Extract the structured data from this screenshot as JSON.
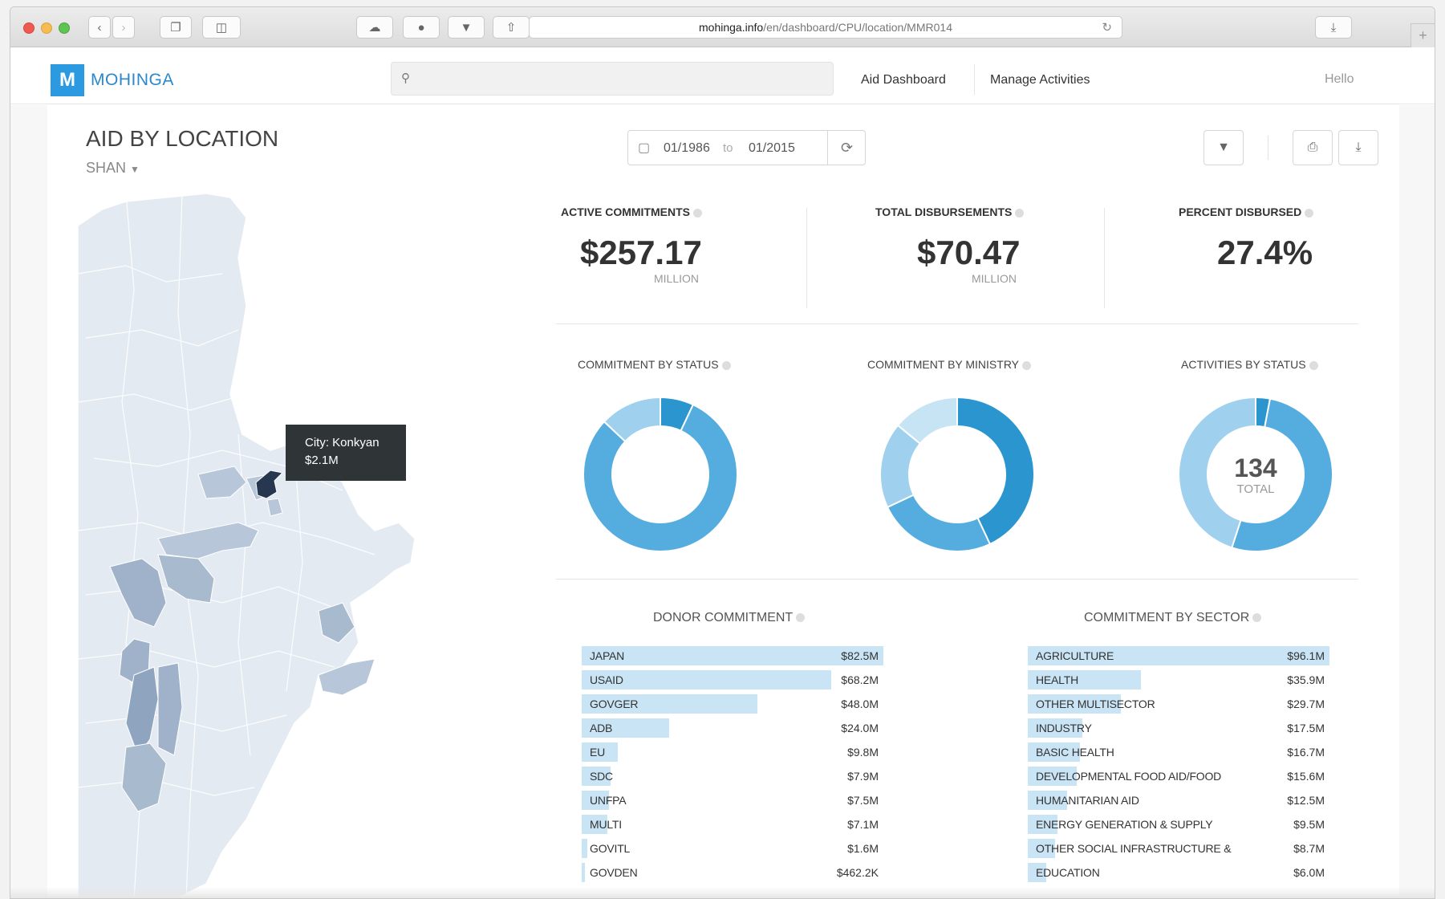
{
  "browser": {
    "url_host": "mohinga.info",
    "url_path": "/en/dashboard/CPU/location/MMR014"
  },
  "header": {
    "logo_letter": "M",
    "logo_text": "MOHINGA",
    "search_placeholder": "",
    "nav": [
      {
        "label": "Aid Dashboard"
      },
      {
        "label": "Manage Activities"
      }
    ],
    "greeting": "Hello"
  },
  "page": {
    "title": "AID BY LOCATION",
    "location": "SHAN",
    "date_from": "01/1986",
    "date_to_word": "to",
    "date_to": "01/2015"
  },
  "tooltip": {
    "line1": "City: Konkyan",
    "line2": "$2.1M"
  },
  "kpis": [
    {
      "label": "ACTIVE COMMITMENTS",
      "value": "$257.17",
      "unit": "MILLION"
    },
    {
      "label": "TOTAL DISBURSEMENTS",
      "value": "$70.47",
      "unit": "MILLION"
    },
    {
      "label": "PERCENT DISBURSED",
      "value": "27.4%",
      "unit": ""
    }
  ],
  "donuts": [
    {
      "label": "COMMITMENT BY STATUS",
      "center_value": "",
      "center_label": "",
      "fractions": [
        0.07,
        0.8,
        0.13
      ],
      "colors": [
        "#2a95cf",
        "#55addf",
        "#9fd0ee"
      ]
    },
    {
      "label": "COMMITMENT BY MINISTRY",
      "center_value": "",
      "center_label": "",
      "fractions": [
        0.43,
        0.25,
        0.18,
        0.14
      ],
      "colors": [
        "#2a95cf",
        "#55addf",
        "#9fd0ee",
        "#c7e4f5"
      ]
    },
    {
      "label": "ACTIVITIES BY STATUS",
      "center_value": "134",
      "center_label": "TOTAL",
      "fractions": [
        0.03,
        0.52,
        0.45
      ],
      "colors": [
        "#2a95cf",
        "#55addf",
        "#9fd0ee"
      ]
    }
  ],
  "donor_commitment": {
    "title": "DONOR COMMITMENT",
    "rows": [
      {
        "name": "JAPAN",
        "value": "$82.5M",
        "fraction": 1.0
      },
      {
        "name": "USAID",
        "value": "$68.2M",
        "fraction": 0.827
      },
      {
        "name": "GOVGER",
        "value": "$48.0M",
        "fraction": 0.582
      },
      {
        "name": "ADB",
        "value": "$24.0M",
        "fraction": 0.291
      },
      {
        "name": "EU",
        "value": "$9.8M",
        "fraction": 0.119
      },
      {
        "name": "SDC",
        "value": "$7.9M",
        "fraction": 0.096
      },
      {
        "name": "UNFPA",
        "value": "$7.5M",
        "fraction": 0.091
      },
      {
        "name": "MULTI",
        "value": "$7.1M",
        "fraction": 0.086
      },
      {
        "name": "GOVITL",
        "value": "$1.6M",
        "fraction": 0.019
      },
      {
        "name": "GOVDEN",
        "value": "$462.2K",
        "fraction": 0.006
      }
    ]
  },
  "sector_commitment": {
    "title": "COMMITMENT BY SECTOR",
    "rows": [
      {
        "name": "AGRICULTURE",
        "value": "$96.1M",
        "fraction": 1.0
      },
      {
        "name": "HEALTH",
        "value": "$35.9M",
        "fraction": 0.374
      },
      {
        "name": "OTHER MULTISECTOR",
        "value": "$29.7M",
        "fraction": 0.309
      },
      {
        "name": "INDUSTRY",
        "value": "$17.5M",
        "fraction": 0.182
      },
      {
        "name": "BASIC HEALTH",
        "value": "$16.7M",
        "fraction": 0.174
      },
      {
        "name": "DEVELOPMENTAL FOOD AID/FOOD",
        "value": "$15.6M",
        "fraction": 0.162
      },
      {
        "name": "HUMANITARIAN AID",
        "value": "$12.5M",
        "fraction": 0.13
      },
      {
        "name": "ENERGY GENERATION & SUPPLY",
        "value": "$9.5M",
        "fraction": 0.099
      },
      {
        "name": "OTHER SOCIAL INFRASTRUCTURE &",
        "value": "$8.7M",
        "fraction": 0.091
      },
      {
        "name": "EDUCATION",
        "value": "$6.0M",
        "fraction": 0.062
      }
    ]
  },
  "colors": {
    "accent": "#2b9ae0",
    "bar_fill": "#c9e4f4",
    "map_base": "#e4eaf1",
    "map_mid": "#b7c6d8",
    "map_dark": "#8ea4bf",
    "map_selected": "#26374f"
  }
}
